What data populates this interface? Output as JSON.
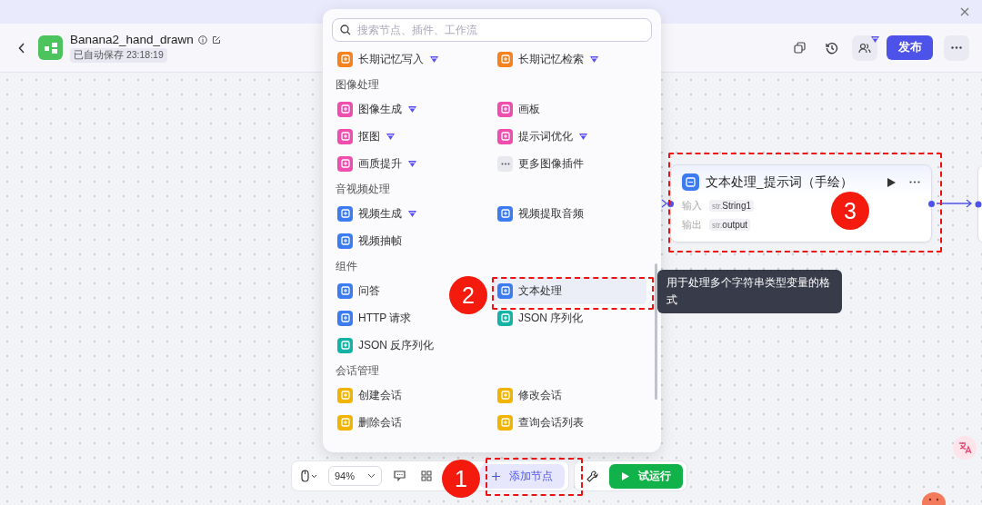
{
  "header": {
    "title": "Banana2_hand_drawn",
    "autosave": "已自动保存 23:18:19",
    "collab_premium": true,
    "publish": "发布"
  },
  "palette": {
    "search_placeholder": "搜索节点、插件、工作流",
    "sections": [
      {
        "items": [
          {
            "kind": "node",
            "label": "长期记忆写入",
            "color": "#f5811f",
            "premium": true,
            "selected": false
          },
          {
            "kind": "node",
            "label": "长期记忆检索",
            "color": "#f5811f",
            "premium": true,
            "selected": false
          }
        ]
      },
      {
        "title": "图像处理",
        "items": [
          {
            "kind": "node",
            "label": "图像生成",
            "color": "#ee4fae",
            "premium": true,
            "selected": false
          },
          {
            "kind": "node",
            "label": "画板",
            "color": "#ee4fae",
            "premium": false,
            "selected": false
          },
          {
            "kind": "node",
            "label": "抠图",
            "color": "#ee4fae",
            "premium": true,
            "selected": false
          },
          {
            "kind": "node",
            "label": "提示词优化",
            "color": "#ee4fae",
            "premium": true,
            "selected": false
          },
          {
            "kind": "node",
            "label": "画质提升",
            "color": "#ee4fae",
            "premium": true,
            "selected": false
          },
          {
            "kind": "more",
            "label": "更多图像插件",
            "premium": false,
            "selected": false
          }
        ]
      },
      {
        "title": "音视频处理",
        "items": [
          {
            "kind": "node",
            "label": "视频生成",
            "color": "#3d7cf0",
            "premium": true,
            "selected": false
          },
          {
            "kind": "node",
            "label": "视频提取音频",
            "color": "#3d7cf0",
            "premium": false,
            "selected": false
          },
          {
            "kind": "node",
            "label": "视频抽帧",
            "color": "#3d7cf0",
            "premium": false,
            "selected": false
          }
        ]
      },
      {
        "title": "组件",
        "items": [
          {
            "kind": "node",
            "label": "问答",
            "color": "#3d7cf0",
            "premium": false,
            "selected": false
          },
          {
            "kind": "node",
            "label": "文本处理",
            "color": "#3d7cf0",
            "premium": false,
            "selected": true
          },
          {
            "kind": "node",
            "label": "HTTP 请求",
            "color": "#3d7cf0",
            "premium": false,
            "selected": false
          },
          {
            "kind": "node",
            "label": "JSON 序列化",
            "color": "#14b3a6",
            "premium": false,
            "selected": false
          },
          {
            "kind": "node",
            "label": "JSON 反序列化",
            "color": "#14b3a6",
            "premium": false,
            "selected": false
          }
        ]
      },
      {
        "title": "会话管理",
        "items": [
          {
            "kind": "node",
            "label": "创建会话",
            "color": "#f0b400",
            "premium": false,
            "selected": false
          },
          {
            "kind": "node",
            "label": "修改会话",
            "color": "#f0b400",
            "premium": false,
            "selected": false
          },
          {
            "kind": "node",
            "label": "删除会话",
            "color": "#f0b400",
            "premium": false,
            "selected": false
          },
          {
            "kind": "node",
            "label": "查询会话列表",
            "color": "#f0b400",
            "premium": false,
            "selected": false
          }
        ]
      }
    ]
  },
  "tooltip": "用于处理多个字符串类型变量的格式",
  "node": {
    "title": "文本处理_提示词（手绘）",
    "rows": [
      {
        "label": "输入",
        "type": "str.",
        "name": "String1"
      },
      {
        "label": "输出",
        "type": "str.",
        "name": "output"
      }
    ]
  },
  "toolbar": {
    "zoom": "94%",
    "add_node": "添加节点",
    "run": "试运行"
  },
  "annotations": [
    {
      "label": "1"
    },
    {
      "label": "2"
    },
    {
      "label": "3"
    }
  ]
}
